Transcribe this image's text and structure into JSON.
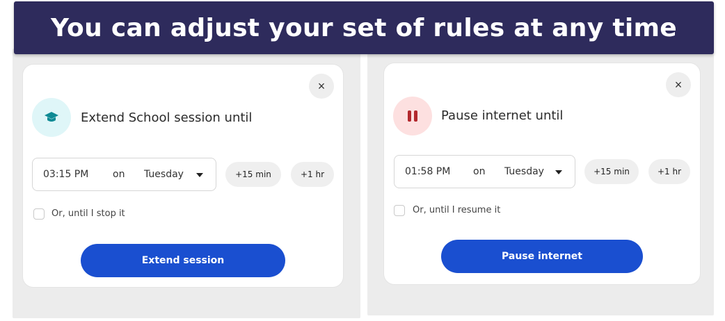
{
  "banner": {
    "title": "You can adjust your set of rules at any time"
  },
  "left_card": {
    "icon": "graduation-cap-icon",
    "icon_bg": "#dff6f8",
    "icon_color": "#0e8a94",
    "heading": "Extend School session until",
    "close": "×",
    "time": "03:15 PM",
    "on": "on",
    "day": "Tuesday",
    "plus15": "+15 min",
    "plus1hr": "+1 hr",
    "checkbox_label": "Or, until I stop it",
    "button": "Extend session"
  },
  "right_card": {
    "icon": "pause-icon",
    "icon_bg": "#fde0e0",
    "icon_color": "#b3282d",
    "heading": "Pause internet until",
    "close": "×",
    "time": "01:58 PM",
    "on": "on",
    "day": "Tuesday",
    "plus15": "+15 min",
    "plus1hr": "+1 hr",
    "checkbox_label": "Or, until I resume it",
    "button": "Pause internet"
  },
  "colors": {
    "primary": "#1a4fd0",
    "banner": "#2e2b5c"
  }
}
